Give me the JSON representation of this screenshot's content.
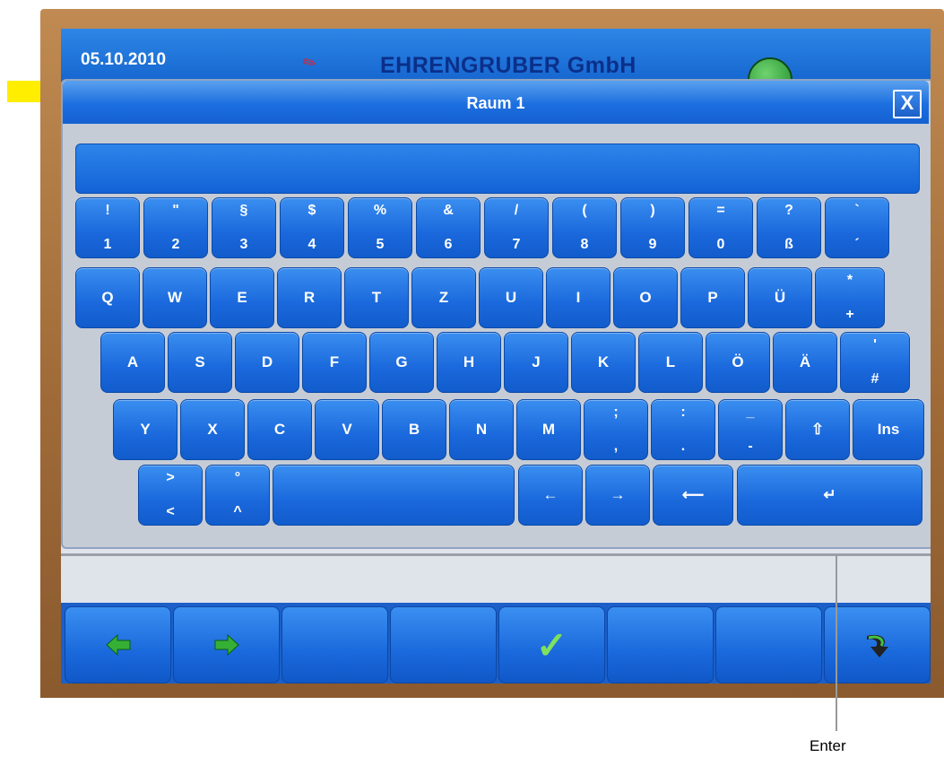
{
  "header": {
    "date": "05.10.2010",
    "brand": "EHRENGRUBER GmbH"
  },
  "dialog": {
    "title": "Raum 1",
    "close_label": "X",
    "input_value": ""
  },
  "keyboard": {
    "row1": [
      {
        "top": "!",
        "bottom": "1"
      },
      {
        "top": "\"",
        "bottom": "2"
      },
      {
        "top": "§",
        "bottom": "3"
      },
      {
        "top": "$",
        "bottom": "4"
      },
      {
        "top": "%",
        "bottom": "5"
      },
      {
        "top": "&",
        "bottom": "6"
      },
      {
        "top": "/",
        "bottom": "7"
      },
      {
        "top": "(",
        "bottom": "8"
      },
      {
        "top": ")",
        "bottom": "9"
      },
      {
        "top": "=",
        "bottom": "0"
      },
      {
        "top": "?",
        "bottom": "ß"
      },
      {
        "top": "`",
        "bottom": "´"
      }
    ],
    "row2": [
      "Q",
      "W",
      "E",
      "R",
      "T",
      "Z",
      "U",
      "I",
      "O",
      "P",
      "Ü"
    ],
    "row2_last": {
      "top": "*",
      "bottom": "+"
    },
    "row3": [
      "A",
      "S",
      "D",
      "F",
      "G",
      "H",
      "J",
      "K",
      "L",
      "Ö",
      "Ä"
    ],
    "row3_last": {
      "top": "'",
      "bottom": "#"
    },
    "row4": [
      "Y",
      "X",
      "C",
      "V",
      "B",
      "N",
      "M"
    ],
    "row4_pairs": [
      {
        "top": ";",
        "bottom": ","
      },
      {
        "top": ":",
        "bottom": "."
      },
      {
        "top": "_",
        "bottom": "-"
      }
    ],
    "shift_icon": "⇧",
    "ins_label": "Ins",
    "row5_pairs": [
      {
        "top": ">",
        "bottom": "<"
      },
      {
        "top": "°",
        "bottom": "^"
      }
    ],
    "left_arrow": "←",
    "right_arrow": "→",
    "backspace": "⟵",
    "enter": "↵"
  },
  "footer": {
    "icons": [
      "back-green-arrow-icon",
      "forward-green-arrow-icon",
      "",
      "",
      "check-icon",
      "",
      "",
      "exit-arrow-icon"
    ],
    "check": "✓"
  },
  "annotation": {
    "enter_label": "Enter",
    "arrow_color": "#ffee00"
  },
  "colors": {
    "key_blue": "#1a68dc",
    "bezel": "#a06b38",
    "brand_text": "#0b2f8a"
  }
}
